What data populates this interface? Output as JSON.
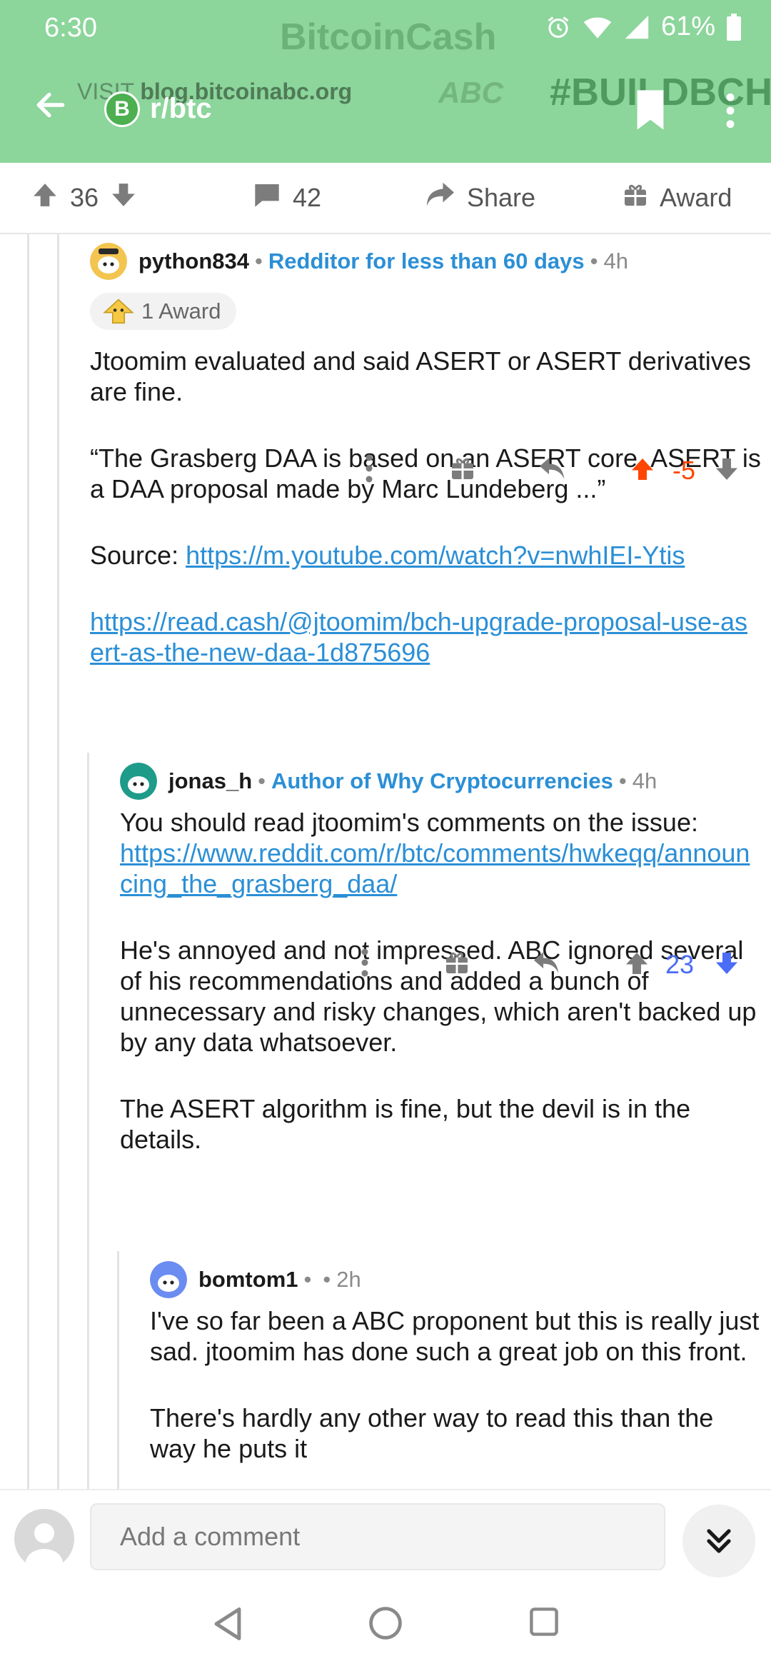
{
  "status_bar": {
    "time": "6:30",
    "battery": "61%"
  },
  "banner": {
    "logo": "BitcoinCash",
    "visit_text": "VISIT",
    "visit_url": "blog.bitcoinabc.org",
    "abc": "ABC",
    "tagline": "#BUILDBCH"
  },
  "header": {
    "subreddit": "r/btc"
  },
  "action_bar": {
    "upvotes": "36",
    "comments": "42",
    "share": "Share",
    "award": "Award"
  },
  "comments": [
    {
      "user": "python834",
      "flair": "Redditor for less than 60 days",
      "time": "4h",
      "award": "1 Award",
      "paragraphs": [
        "Jtoomim evaluated and said ASERT or ASERT derivatives are fine.",
        "“The Grasberg DAA is based on an ASERT core. ASERT is a DAA proposal made by Marc Lundeberg ...”"
      ],
      "source_label": "Source:",
      "link1": "https://m.youtube.com/watch?v=nwhIEI-Ytis",
      "link2": "https://read.cash/@jtoomim/bch-upgrade-proposal-use-asert-as-the-new-daa-1d875696",
      "score": "-5"
    },
    {
      "user": "jonas_h",
      "flair": "Author of Why Cryptocurrencies",
      "time": "4h",
      "intro": "You should read jtoomim's comments on the issue:",
      "link": "https://www.reddit.com/r/btc/comments/hwkeqq/announcing_the_grasberg_daa/",
      "paragraphs": [
        "He's annoyed and not impressed. ABC ignored several of his recommendations and added a bunch of unnecessary and risky changes, which aren't backed up by any data whatsoever.",
        "The ASERT algorithm is fine, but the devil is in the details."
      ],
      "score": "23"
    },
    {
      "user": "bomtom1",
      "time": "2h",
      "paragraphs": [
        "I've so far been a ABC proponent but this is really just sad. jtoomim has done such a great job on this front.",
        "There's hardly any other way to read this than the way he puts it"
      ]
    }
  ],
  "composer": {
    "placeholder": "Add a comment"
  },
  "colors": {
    "header_bg": "#8cd59b",
    "link": "#2b8fd6",
    "upvoted": "#ff4500",
    "downvoted": "#4a6cf7"
  }
}
